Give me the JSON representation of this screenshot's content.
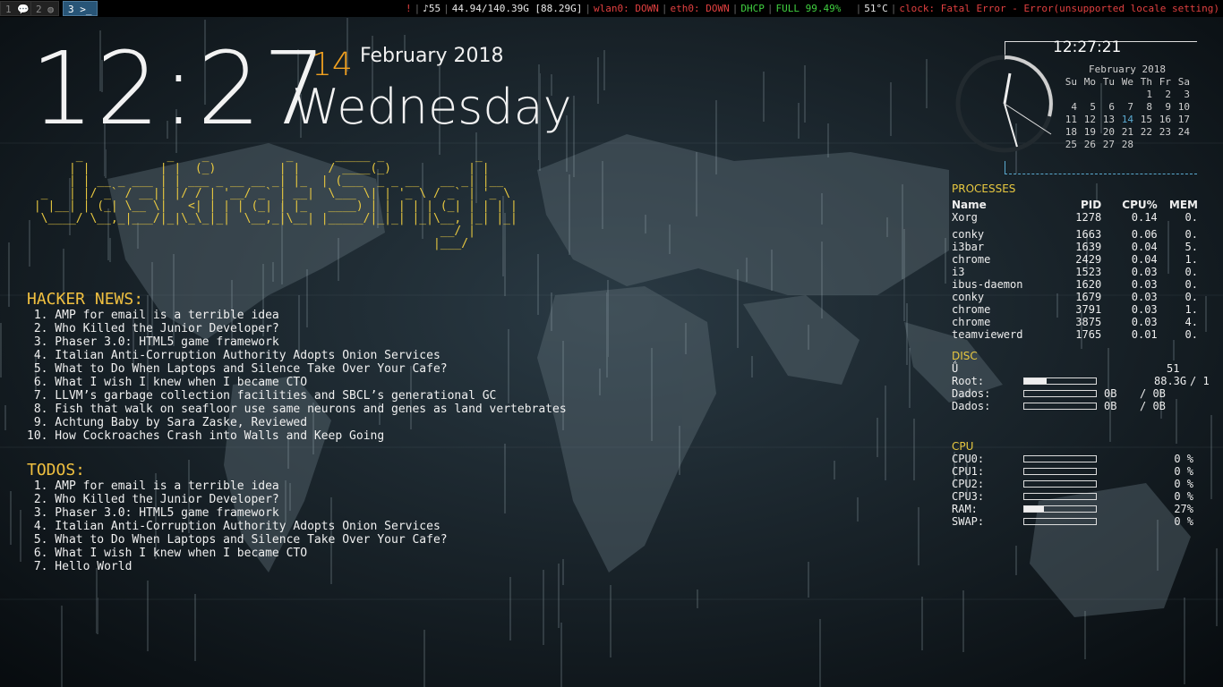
{
  "topbar": {
    "workspaces": [
      {
        "num": "1",
        "icon": "chat-icon",
        "focused": false
      },
      {
        "num": "2",
        "icon": "globe-icon",
        "focused": false
      },
      {
        "num": "3",
        "icon": "terminal-icon",
        "focused": true
      }
    ],
    "ws1_label": "1",
    "ws2_label": "2",
    "ws3_label": "3",
    "alert": "!",
    "volume": "♪55",
    "disk": "44.94/140.39G [88.29G]",
    "wlan": "wlan0: DOWN",
    "eth": "eth0: DOWN",
    "dhcp": "DHCP",
    "battery": "FULL 99.49%",
    "temp": "51°C",
    "clock_error": "clock: Fatal Error - Error(unsupported locale setting)"
  },
  "datetime": {
    "time": "12:27",
    "day": "14",
    "month_year": "February 2018",
    "weekday": "Wednesday",
    "clock_seconds": "12:27:21"
  },
  "banner_name": "Jaskirat Singh",
  "hacker_news": {
    "title": "HACKER NEWS:",
    "items": [
      " 1. AMP for email is a terrible idea",
      " 2. Who Killed the Junior Developer?",
      " 3. Phaser 3.0: HTML5 game framework",
      " 4. Italian Anti-Corruption Authority Adopts Onion Services",
      " 5. What to Do When Laptops and Silence Take Over Your Cafe?",
      " 6. What I wish I knew when I became CTO",
      " 7. LLVM’s garbage collection facilities and SBCL’s generational GC",
      " 8. Fish that walk on seafloor use same neurons and genes as land vertebrates",
      " 9. Achtung Baby by Sara Zaske, Reviewed",
      "10. How Cockroaches Crash into Walls and Keep Going"
    ]
  },
  "todos": {
    "title": "TODOS:",
    "items": [
      " 1. AMP for email is a terrible idea",
      " 2. Who Killed the Junior Developer?",
      " 3. Phaser 3.0: HTML5 game framework",
      " 4. Italian Anti-Corruption Authority Adopts Onion Services",
      " 5. What to Do When Laptops and Silence Take Over Your Cafe?",
      " 6. What I wish I knew when I became CTO",
      " 7. Hello World"
    ]
  },
  "calendar": {
    "title": "February 2018",
    "weekdays": [
      "Su",
      "Mo",
      "Tu",
      "We",
      "Th",
      "Fr",
      "Sa"
    ],
    "weeks": [
      [
        "",
        "",
        "",
        "",
        "1",
        "2",
        "3"
      ],
      [
        "4",
        "5",
        "6",
        "7",
        "8",
        "9",
        "10"
      ],
      [
        "11",
        "12",
        "13",
        "14",
        "15",
        "16",
        "17"
      ],
      [
        "18",
        "19",
        "20",
        "21",
        "22",
        "23",
        "24"
      ],
      [
        "25",
        "26",
        "27",
        "28",
        "",
        "",
        ""
      ]
    ],
    "today": "14"
  },
  "processes": {
    "title": "PROCESSES",
    "headers": [
      "Name",
      "PID",
      "CPU%",
      "MEM"
    ],
    "rows": [
      [
        "Xorg",
        "1278",
        "0.14",
        "0."
      ],
      [
        "conky",
        "1663",
        "0.06",
        "0."
      ],
      [
        "i3bar",
        "1639",
        "0.04",
        "5."
      ],
      [
        "chrome",
        "2429",
        "0.04",
        "1."
      ],
      [
        "i3",
        "1523",
        "0.03",
        "0."
      ],
      [
        "ibus-daemon",
        "1620",
        "0.03",
        "0."
      ],
      [
        "conky",
        "1679",
        "0.03",
        "0."
      ],
      [
        "chrome",
        "3791",
        "0.03",
        "1."
      ],
      [
        "chrome",
        "3875",
        "0.03",
        "4."
      ],
      [
        "teamviewerd",
        "1765",
        "0.01",
        "0."
      ]
    ]
  },
  "disc": {
    "title": "DISC",
    "glyph": "Ǘ",
    "top_value": "51",
    "rows": [
      {
        "label": "Root:",
        "usage": 0.31,
        "used": "88.3G",
        "total": "/ 1"
      },
      {
        "label": "Dados:",
        "usage": 0,
        "used": "0B",
        "total": "/ 0B"
      },
      {
        "label": "Dados:",
        "usage": 0,
        "used": "0B",
        "total": "/ 0B"
      }
    ]
  },
  "cpu": {
    "title": "CPU",
    "rows": [
      {
        "label": "CPU0:",
        "usage": 0,
        "pct": "0 %"
      },
      {
        "label": "CPU1:",
        "usage": 0,
        "pct": "0 %"
      },
      {
        "label": "CPU2:",
        "usage": 0,
        "pct": "0 %"
      },
      {
        "label": "CPU3:",
        "usage": 0,
        "pct": "0 %"
      },
      {
        "label": "RAM:",
        "usage": 0.27,
        "pct": "27%"
      },
      {
        "label": "SWAP:",
        "usage": 0,
        "pct": "0 %"
      }
    ]
  },
  "colors": {
    "accent_yellow": "#f0c040",
    "orange_day": "#f0a020",
    "calendar_today": "#5aaad0",
    "status_down": "#e04040",
    "status_ok": "#40d040"
  }
}
